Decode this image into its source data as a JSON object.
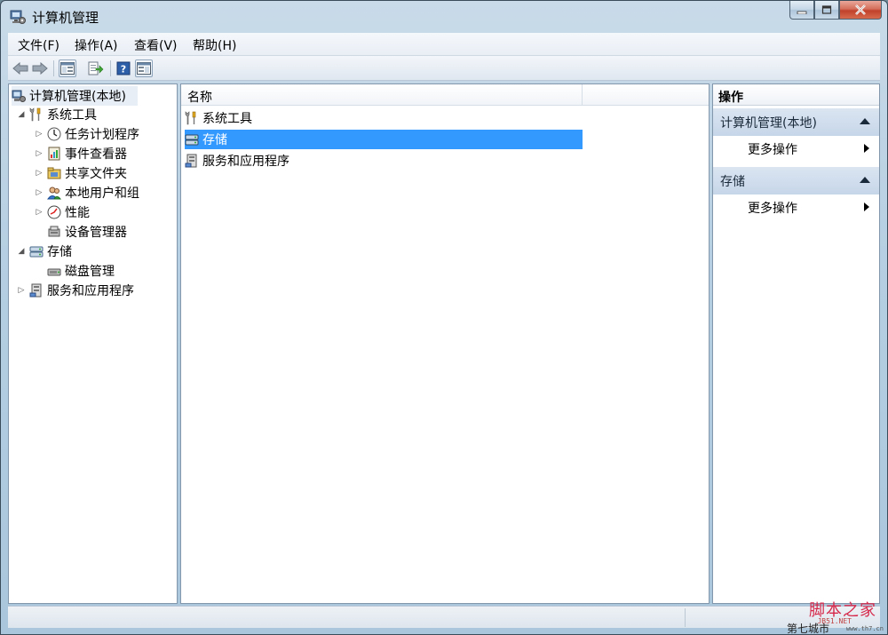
{
  "window": {
    "title": "计算机管理"
  },
  "menu": {
    "items": [
      "文件(F)",
      "操作(A)",
      "查看(V)",
      "帮助(H)"
    ]
  },
  "tree": {
    "items": [
      {
        "label": "计算机管理(本地)",
        "level": 0,
        "expander": "",
        "icon": "computer-management-icon"
      },
      {
        "label": "系统工具",
        "level": 1,
        "expander": "expanded",
        "icon": "system-tools-icon"
      },
      {
        "label": "任务计划程序",
        "level": 2,
        "expander": "collapsed",
        "icon": "task-scheduler-icon"
      },
      {
        "label": "事件查看器",
        "level": 2,
        "expander": "collapsed",
        "icon": "event-viewer-icon"
      },
      {
        "label": "共享文件夹",
        "level": 2,
        "expander": "collapsed",
        "icon": "shared-folders-icon"
      },
      {
        "label": "本地用户和组",
        "level": 2,
        "expander": "collapsed",
        "icon": "local-users-icon"
      },
      {
        "label": "性能",
        "level": 2,
        "expander": "collapsed",
        "icon": "performance-icon"
      },
      {
        "label": "设备管理器",
        "level": 2,
        "expander": "",
        "icon": "device-manager-icon"
      },
      {
        "label": "存储",
        "level": 1,
        "expander": "expanded",
        "icon": "storage-icon"
      },
      {
        "label": "磁盘管理",
        "level": 2,
        "expander": "",
        "icon": "disk-management-icon"
      },
      {
        "label": "服务和应用程序",
        "level": 1,
        "expander": "collapsed",
        "icon": "services-apps-icon"
      }
    ]
  },
  "list": {
    "column_name": "名称",
    "rows": [
      {
        "label": "系统工具",
        "icon": "system-tools-icon",
        "selected": false
      },
      {
        "label": "存储",
        "icon": "storage-icon",
        "selected": true
      },
      {
        "label": "服务和应用程序",
        "icon": "services-apps-icon",
        "selected": false
      }
    ]
  },
  "actions": {
    "header": "操作",
    "sections": [
      {
        "title": "计算机管理(本地)",
        "item": "更多操作"
      },
      {
        "title": "存储",
        "item": "更多操作"
      }
    ]
  },
  "watermark": {
    "main": "脚本之家",
    "sub": "JB51.NET",
    "left": "第七城市",
    "url": "www.th7.cn"
  },
  "colors": {
    "selection": "#3399ff",
    "close_button": "#c0412b"
  }
}
